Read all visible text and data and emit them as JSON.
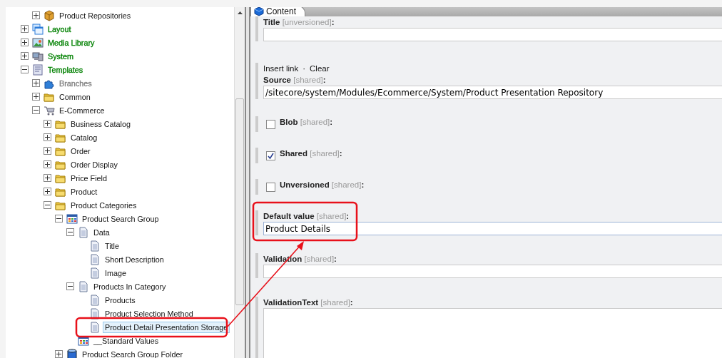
{
  "tree": {
    "continued_items": [
      {
        "label": "Product Repositories",
        "kind": "cube",
        "expanded": false,
        "selected": false
      }
    ],
    "items": [
      {
        "label": "Layout",
        "kind": "layout",
        "expanded": false,
        "selected": false,
        "color": "#008000"
      },
      {
        "label": "Media Library",
        "kind": "media",
        "expanded": false,
        "selected": false,
        "color": "#008000"
      },
      {
        "label": "System",
        "kind": "system",
        "expanded": false,
        "selected": false,
        "color": "#008000"
      },
      {
        "label": "Templates",
        "kind": "template",
        "expanded": true,
        "selected": false,
        "color": "#008000",
        "children": [
          {
            "label": "Branches",
            "kind": "branches",
            "expanded": false,
            "selected": false,
            "color": "#808080"
          },
          {
            "label": "Common",
            "kind": "folder",
            "expanded": false,
            "selected": false
          },
          {
            "label": "E-Commerce",
            "kind": "ecommerce",
            "expanded": true,
            "selected": false,
            "children": [
              {
                "label": "Business Catalog",
                "kind": "folder",
                "expanded": false,
                "selected": false
              },
              {
                "label": "Catalog",
                "kind": "folder",
                "expanded": false,
                "selected": false
              },
              {
                "label": "Order",
                "kind": "folder",
                "expanded": false,
                "selected": false
              },
              {
                "label": "Order Display",
                "kind": "folder",
                "expanded": false,
                "selected": false
              },
              {
                "label": "Price Field",
                "kind": "folder",
                "expanded": false,
                "selected": false
              },
              {
                "label": "Product",
                "kind": "folder",
                "expanded": false,
                "selected": false
              },
              {
                "label": "Product Categories",
                "kind": "folder",
                "expanded": true,
                "selected": false,
                "children": [
                  {
                    "label": "Product Search Group",
                    "kind": "grid",
                    "expanded": true,
                    "selected": false,
                    "children": [
                      {
                        "label": "Data",
                        "kind": "doc",
                        "expanded": true,
                        "selected": false,
                        "children": [
                          {
                            "label": "Title",
                            "kind": "doc",
                            "selected": false
                          },
                          {
                            "label": "Short Description",
                            "kind": "doc",
                            "selected": false
                          },
                          {
                            "label": "Image",
                            "kind": "doc",
                            "selected": false
                          }
                        ]
                      },
                      {
                        "label": "Products In Category",
                        "kind": "doc",
                        "expanded": true,
                        "selected": false,
                        "children": [
                          {
                            "label": "Products",
                            "kind": "doc",
                            "selected": false
                          },
                          {
                            "label": "Product Selection Method",
                            "kind": "doc",
                            "selected": false
                          },
                          {
                            "label": "Product Detail Presentation Storage",
                            "kind": "doc",
                            "selected": true
                          }
                        ]
                      },
                      {
                        "label": "__Standard Values",
                        "kind": "grid",
                        "selected": false
                      }
                    ]
                  },
                  {
                    "label": "Product Search Group Folder",
                    "kind": "cylinder",
                    "expanded": false,
                    "selected": false
                  }
                ]
              }
            ]
          }
        ]
      }
    ]
  },
  "editor": {
    "tab": {
      "label": "Content",
      "selected": true
    },
    "fields": [
      {
        "kind": "text",
        "label": "**Title** [unversioned]**:**"
      },
      {
        "kind": "link",
        "actions": [
          "Insert link",
          "Clear"
        ],
        "separator": "·",
        "label": "**Source** [shared]**:**",
        "value": "/sitecore/system/Modules/Ecommerce/System/Product Presentation Repository"
      },
      {
        "kind": "checkbox",
        "label": "**Blob** [shared]**:**",
        "checked": false
      },
      {
        "kind": "checkbox",
        "label": "**Shared** [shared]**:**",
        "checked": true
      },
      {
        "kind": "checkbox",
        "label": "**Unversioned** [shared]**:**",
        "checked": false
      },
      {
        "kind": "text",
        "label": "**Default value** [shared]**:**",
        "value": "Product Details"
      },
      {
        "kind": "text",
        "label": "**Validation** [shared]**:**"
      },
      {
        "kind": "multiline",
        "label": "**ValidationText** [shared]**:**"
      }
    ]
  }
}
